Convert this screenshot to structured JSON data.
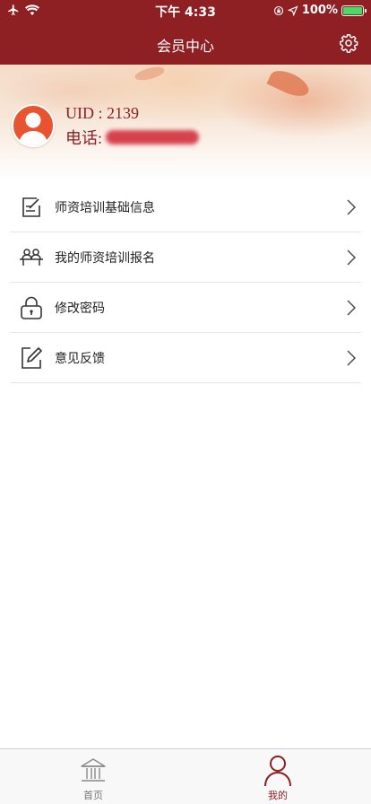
{
  "status_bar": {
    "time": "下午 4:33",
    "battery_percent": "100%",
    "battery_level": 1.0,
    "icons": [
      "airplane-icon",
      "wifi-icon",
      "lock-rotation-icon",
      "location-icon",
      "battery-icon"
    ]
  },
  "header": {
    "title": "会员中心",
    "settings_icon": "gear-icon"
  },
  "profile": {
    "uid": "UID : 2139",
    "phone_label": "电话:",
    "avatar_icon": "user-avatar-icon"
  },
  "menu": {
    "items": [
      {
        "label": "师资培训基础信息",
        "icon": "edit-document-icon"
      },
      {
        "label": "我的师资培训报名",
        "icon": "classroom-icon"
      },
      {
        "label": "修改密码",
        "icon": "lock-icon"
      },
      {
        "label": "意见反馈",
        "icon": "pencil-square-icon"
      }
    ]
  },
  "tabbar": {
    "tabs": [
      {
        "label": "首页",
        "icon": "home-building-icon",
        "active": false
      },
      {
        "label": "我的",
        "icon": "person-icon",
        "active": true
      }
    ]
  },
  "colors": {
    "brand": "#8e1f22",
    "avatar_bg": "#e8542f",
    "battery": "#4cd964"
  }
}
